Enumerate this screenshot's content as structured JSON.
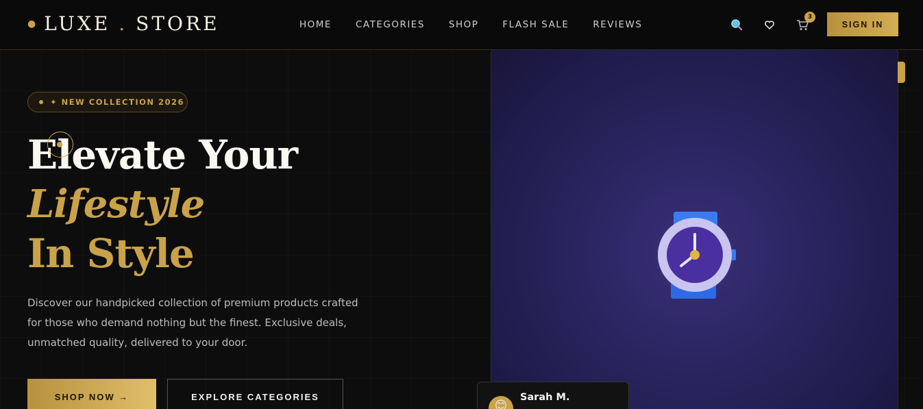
{
  "brand": {
    "name_left": "LUXE",
    "name_right": "STORE",
    "dot": "."
  },
  "nav": {
    "links": [
      "HOME",
      "CATEGORIES",
      "SHOP",
      "FLASH SALE",
      "REVIEWS"
    ],
    "cart_count": "3",
    "signin_label": "SIGN IN",
    "icons": [
      "search-icon",
      "heart-icon",
      "cart-icon"
    ]
  },
  "hero": {
    "badge": "✦ NEW COLLECTION 2026",
    "title_line1": "Elevate Your",
    "title_line2": "Lifestyle",
    "title_line3": "In Style",
    "description": "Discover our handpicked collection of premium products crafted for those who demand nothing but the finest. Exclusive deals, unmatched quality, delivered to your door.",
    "primary_cta": "SHOP NOW →",
    "secondary_cta": "EXPLORE CATEGORIES"
  },
  "review": {
    "name": "Sarah M."
  },
  "colors": {
    "accent": "#c9a24a",
    "background": "#0d0d0d",
    "card": "#2a2560"
  }
}
